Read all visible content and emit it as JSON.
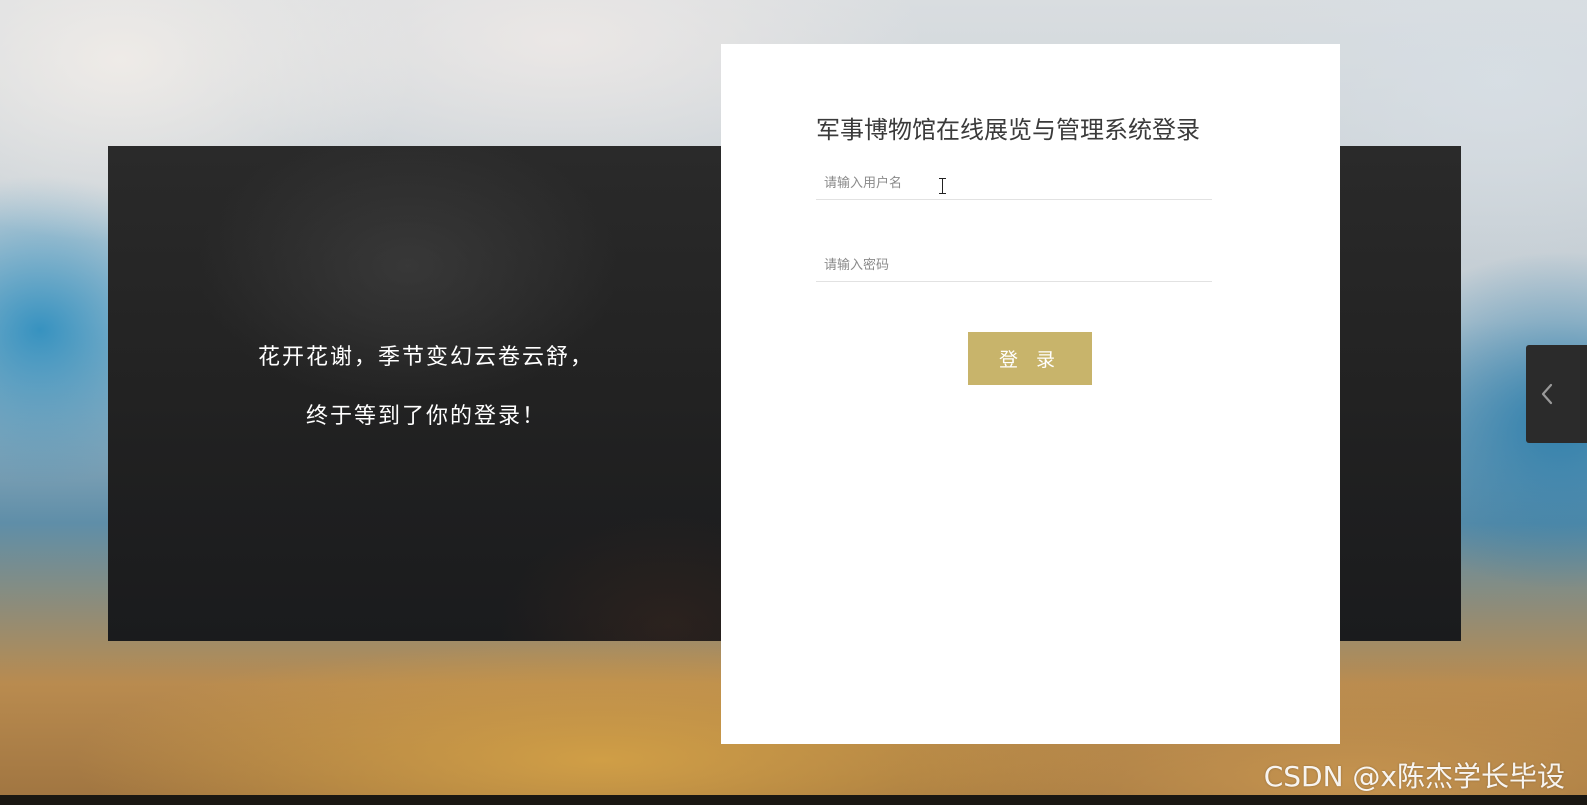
{
  "banner": {
    "greeting_line1": "花开花谢，季节变幻云卷云舒，",
    "greeting_line2": "终于等到了你的登录！"
  },
  "login": {
    "title": "军事博物馆在线展览与管理系统登录",
    "username_placeholder": "请输入用户名",
    "password_placeholder": "请输入密码",
    "submit_label": "登 录",
    "accent_color": "#c8b46b"
  },
  "side_tab": {
    "icon": "chevron-left-icon"
  },
  "watermark": {
    "text": "CSDN @x陈杰学长毕设"
  }
}
